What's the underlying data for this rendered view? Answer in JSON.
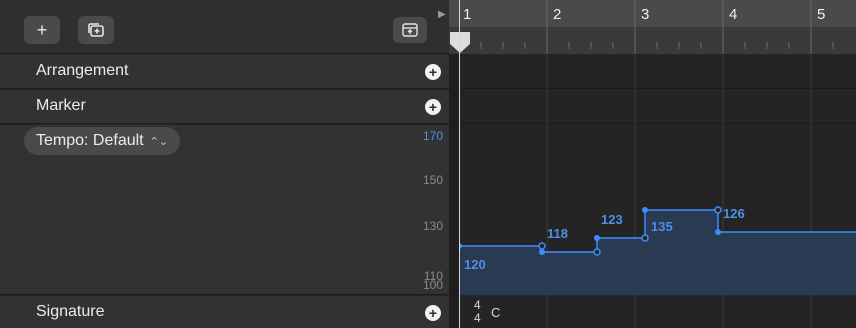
{
  "toolbar": {
    "add_label": "+"
  },
  "tracks": [
    {
      "name": "Arrangement"
    },
    {
      "name": "Marker"
    },
    {
      "name": "Tempo: Default"
    },
    {
      "name": "Signature"
    }
  ],
  "tempo_track": {
    "scale_labels": [
      "170",
      "150",
      "130",
      "110",
      "100"
    ],
    "points": [
      {
        "label": "120"
      },
      {
        "label": "118"
      },
      {
        "label": "123"
      },
      {
        "label": "135"
      },
      {
        "label": "126"
      }
    ]
  },
  "ruler": {
    "bars": [
      "1",
      "2",
      "3",
      "4",
      "5"
    ]
  },
  "signature": {
    "time_top": "4",
    "time_bottom": "4",
    "key": "C"
  },
  "colors": {
    "tempo_line": "#3b8cff",
    "tempo_fill": "#2a3a52",
    "scale_highlight": "#4f8fe8"
  }
}
